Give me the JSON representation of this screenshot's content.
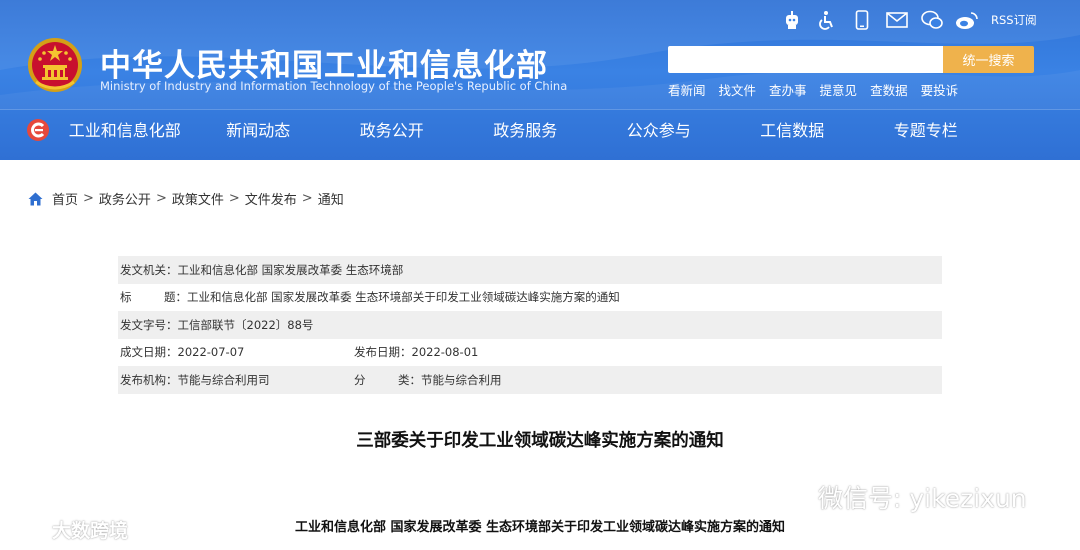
{
  "header": {
    "site_title": "中华人民共和国工业和信息化部",
    "site_subtitle": "Ministry of Industry and Information Technology of the People's Republic of China",
    "rss_label": "RSS订阅",
    "search": {
      "placeholder": "",
      "button_label": "统一搜索"
    },
    "quick_links": [
      "看新闻",
      "找文件",
      "查办事",
      "提意见",
      "查数据",
      "要投诉"
    ],
    "util_icons": [
      "robot-icon",
      "accessibility-icon",
      "mobile-icon",
      "mail-icon",
      "wechat-icon",
      "weibo-icon"
    ]
  },
  "nav": {
    "items": [
      "工业和信息化部",
      "新闻动态",
      "政务公开",
      "政务服务",
      "公众参与",
      "工信数据",
      "专题专栏"
    ]
  },
  "breadcrumb": {
    "items": [
      "首页",
      "政务公开",
      "政策文件",
      "文件发布",
      "通知"
    ],
    "separator": ">"
  },
  "info": {
    "issuer_label": "发文机关：",
    "issuer": "工业和信息化部 国家发展改革委 生态环境部",
    "title_label_a": "标",
    "title_label_b": "题：",
    "title": "工业和信息化部 国家发展改革委 生态环境部关于印发工业领域碳达峰实施方案的通知",
    "docno_label": "发文字号：",
    "docno": "工信部联节〔2022〕88号",
    "created_label": "成文日期：",
    "created": "2022-07-07",
    "published_label": "发布日期：",
    "published": "2022-08-01",
    "org_label": "发布机构：",
    "org": "节能与综合利用司",
    "category_label_a": "分",
    "category_label_b": "类：",
    "category": "节能与综合利用"
  },
  "article": {
    "title": "三部委关于印发工业领域碳达峰实施方案的通知",
    "subtitle": "工业和信息化部 国家发展改革委 生态环境部关于印发工业领域碳达峰实施方案的通知"
  },
  "watermarks": {
    "left_text": "大数跨境",
    "right_text": "微信号: yikezixun"
  },
  "colors": {
    "header_blue": "#3a82e4",
    "search_button": "#efb24c",
    "row_shade": "#efefef"
  }
}
